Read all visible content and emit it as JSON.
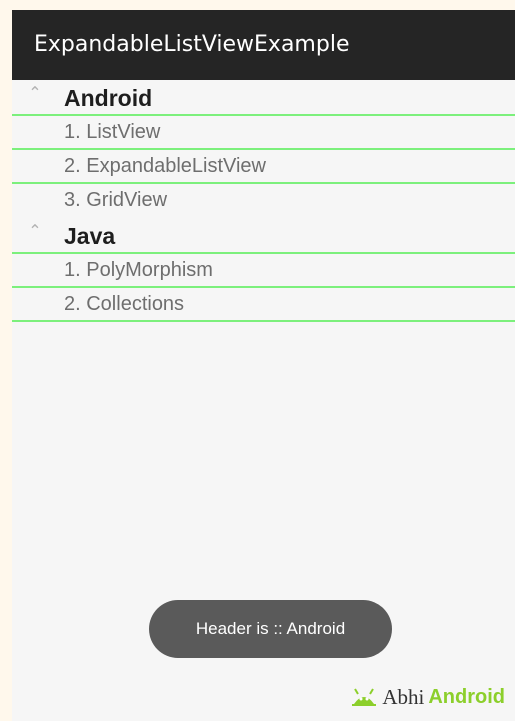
{
  "app": {
    "title": "ExpandableListViewExample"
  },
  "list": {
    "groups": [
      {
        "title": "Android",
        "children": [
          "1. ListView",
          "2. ExpandableListView",
          "3. GridView"
        ]
      },
      {
        "title": "Java",
        "children": [
          "1. PolyMorphism",
          "2. Collections"
        ]
      }
    ]
  },
  "indicator_icon": "chevron-up-icon",
  "toast": {
    "text": "Header is :: Android"
  },
  "watermark": {
    "part1": "Abhi",
    "part2": "Android"
  },
  "colors": {
    "divider": "#7cf07c",
    "actionbar": "#252525",
    "watermark_accent": "#8ccf2b"
  }
}
